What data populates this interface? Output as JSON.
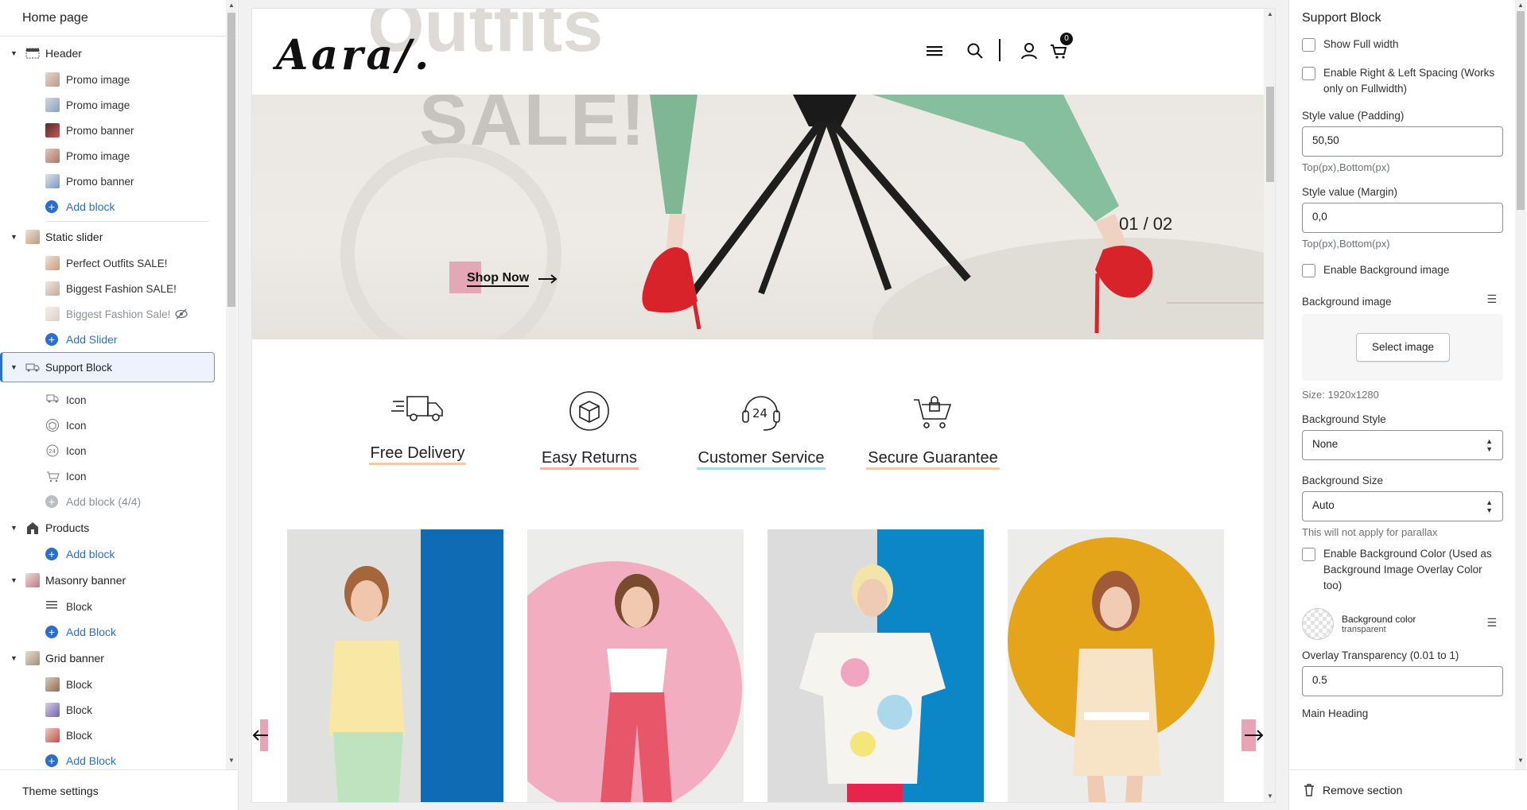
{
  "left": {
    "title": "Home page",
    "sections": [
      {
        "name": "Header",
        "blocks": [
          "Promo image",
          "Promo image",
          "Promo banner",
          "Promo image",
          "Promo banner"
        ],
        "add": "Add block"
      },
      {
        "name": "Static slider",
        "blocks": [
          "Perfect Outfits SALE!",
          "Biggest Fashion SALE!",
          "Biggest Fashion Sale!"
        ],
        "add": "Add Slider"
      },
      {
        "name": "Support Block",
        "blocks": [
          "Icon",
          "Icon",
          "Icon",
          "Icon"
        ],
        "add": "Add block (4/4)"
      },
      {
        "name": "Products",
        "blocks": [],
        "add": "Add block"
      },
      {
        "name": "Masonry banner",
        "blocks": [
          "Block"
        ],
        "add": "Add Block"
      },
      {
        "name": "Grid banner",
        "blocks": [
          "Block",
          "Block",
          "Block"
        ],
        "add": "Add Block"
      }
    ],
    "footer": "Theme settings"
  },
  "preview": {
    "logo": "Aara/.",
    "cart_count": "0",
    "hero_text": "SALE!",
    "hero_text_top": "Outfits",
    "shop_now": "Shop Now",
    "slide_counter": "01 / 02",
    "features": [
      "Free Delivery",
      "Easy Returns",
      "Customer Service",
      "Secure Guarantee"
    ],
    "feature_underlines": [
      "#f5c9a7",
      "#f1b6a4",
      "#a7dde6",
      "#f5c9a7"
    ]
  },
  "right": {
    "title": "Support Block",
    "show_full_width": "Show Full width",
    "enable_spacing": "Enable Right & Left Spacing (Works only on Fullwidth)",
    "padding_label": "Style value (Padding)",
    "padding_value": "50,50",
    "padding_help": "Top(px),Bottom(px)",
    "margin_label": "Style value (Margin)",
    "margin_value": "0,0",
    "margin_help": "Top(px),Bottom(px)",
    "enable_bg_image": "Enable Background image",
    "bg_image_label": "Background image",
    "select_image": "Select image",
    "size_text": "Size: 1920x1280",
    "bg_style_label": "Background Style",
    "bg_style_value": "None",
    "bg_size_label": "Background Size",
    "bg_size_value": "Auto",
    "bg_size_help": "This will not apply for parallax",
    "enable_bg_color": "Enable Background Color (Used as Background Image Overlay Color too)",
    "bg_color_label": "Background color",
    "bg_color_value": "transparent",
    "overlay_label": "Overlay Transparency (0.01 to 1)",
    "overlay_value": "0.5",
    "main_heading_label": "Main Heading",
    "remove_section": "Remove section"
  }
}
